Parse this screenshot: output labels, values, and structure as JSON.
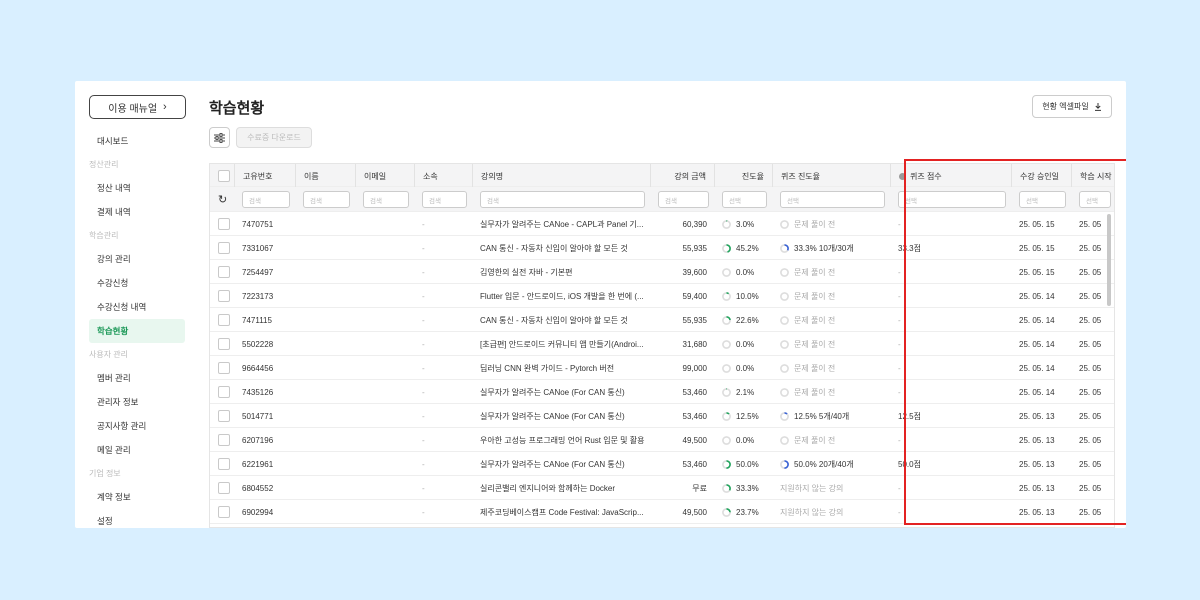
{
  "sidebar": {
    "menu_button": "이용 매뉴얼",
    "sections": [
      {
        "items": [
          "대시보드"
        ]
      },
      {
        "title": "정산관리",
        "items": [
          "정산 내역",
          "결제 내역"
        ]
      },
      {
        "title": "학습관리",
        "items": [
          "강의 관리",
          "수강신청",
          "수강신청 내역",
          "학습현황"
        ]
      },
      {
        "title": "사용자 관리",
        "items": [
          "멤버 관리",
          "관리자 정보",
          "공지사항 관리",
          "메일 관리"
        ]
      },
      {
        "title": "기업 정보",
        "items": [
          "계약 정보",
          "설정"
        ]
      }
    ],
    "active_item": "학습현황"
  },
  "header": {
    "title": "학습현황",
    "excel_button": "현황 엑셀파일",
    "certificate_download": "수료증 다운로드"
  },
  "table": {
    "columns": [
      "고유번호",
      "이름",
      "이메일",
      "소속",
      "강의명",
      "강의 금액",
      "진도율",
      "퀴즈 진도율",
      "퀴즈 점수",
      "수강 승인일",
      "학습 시작"
    ],
    "filter_placeholders": {
      "search": "검색",
      "select": "선택"
    },
    "rows": [
      {
        "id": "7470751",
        "org": "-",
        "course": "실무자가 알려주는 CANoe - CAPL과 Panel 기...",
        "price": "60,390",
        "progress": "3.0%",
        "progress_frac": 0.03,
        "quiz_progress": "문제 풀이 전",
        "quiz_frac": null,
        "quiz_score": "-",
        "approved": "25. 05. 15",
        "start": "25. 05"
      },
      {
        "id": "7331067",
        "org": "-",
        "course": "CAN 통신 - 자동차 신입이 알아야 할 모든 것",
        "price": "55,935",
        "progress": "45.2%",
        "progress_frac": 0.452,
        "quiz_progress": "33.3% 10개/30개",
        "quiz_frac": 0.333,
        "quiz_score": "33.3점",
        "approved": "25. 05. 15",
        "start": "25. 05"
      },
      {
        "id": "7254497",
        "org": "-",
        "course": "김영한의 실전 자바 - 기본편",
        "price": "39,600",
        "progress": "0.0%",
        "progress_frac": 0,
        "quiz_progress": "문제 풀이 전",
        "quiz_frac": null,
        "quiz_score": "-",
        "approved": "25. 05. 15",
        "start": "25. 05"
      },
      {
        "id": "7223173",
        "org": "-",
        "course": "Flutter 입문 - 안드로이드, iOS 개발을 한 번에 (...",
        "price": "59,400",
        "progress": "10.0%",
        "progress_frac": 0.1,
        "quiz_progress": "문제 풀이 전",
        "quiz_frac": null,
        "quiz_score": "-",
        "approved": "25. 05. 14",
        "start": "25. 05"
      },
      {
        "id": "7471115",
        "org": "-",
        "course": "CAN 통신 - 자동차 신입이 알아야 할 모든 것",
        "price": "55,935",
        "progress": "22.6%",
        "progress_frac": 0.226,
        "quiz_progress": "문제 풀이 전",
        "quiz_frac": null,
        "quiz_score": "-",
        "approved": "25. 05. 14",
        "start": "25. 05"
      },
      {
        "id": "5502228",
        "org": "-",
        "course": "[초급편] 안드로이드 커뮤니티 앱 만들기(Androi...",
        "price": "31,680",
        "progress": "0.0%",
        "progress_frac": 0,
        "quiz_progress": "문제 풀이 전",
        "quiz_frac": null,
        "quiz_score": "-",
        "approved": "25. 05. 14",
        "start": "25. 05"
      },
      {
        "id": "9664456",
        "org": "-",
        "course": "딥러닝 CNN 완벽 가이드 - Pytorch 버전",
        "price": "99,000",
        "progress": "0.0%",
        "progress_frac": 0,
        "quiz_progress": "문제 풀이 전",
        "quiz_frac": null,
        "quiz_score": "-",
        "approved": "25. 05. 14",
        "start": "25. 05"
      },
      {
        "id": "7435126",
        "org": "-",
        "course": "실무자가 알려주는 CANoe (For CAN 통신)",
        "price": "53,460",
        "progress": "2.1%",
        "progress_frac": 0.021,
        "quiz_progress": "문제 풀이 전",
        "quiz_frac": null,
        "quiz_score": "-",
        "approved": "25. 05. 14",
        "start": "25. 05"
      },
      {
        "id": "5014771",
        "org": "-",
        "course": "실무자가 알려주는 CANoe (For CAN 통신)",
        "price": "53,460",
        "progress": "12.5%",
        "progress_frac": 0.125,
        "quiz_progress": "12.5% 5개/40개",
        "quiz_frac": 0.125,
        "quiz_score": "12.5점",
        "approved": "25. 05. 13",
        "start": "25. 05"
      },
      {
        "id": "6207196",
        "org": "-",
        "course": "우아한 고성능 프로그래밍 언어 Rust 입문 및 활용",
        "price": "49,500",
        "progress": "0.0%",
        "progress_frac": 0,
        "quiz_progress": "문제 풀이 전",
        "quiz_frac": null,
        "quiz_score": "-",
        "approved": "25. 05. 13",
        "start": "25. 05"
      },
      {
        "id": "6221961",
        "org": "-",
        "course": "실무자가 알려주는 CANoe (For CAN 통신)",
        "price": "53,460",
        "progress": "50.0%",
        "progress_frac": 0.5,
        "quiz_progress": "50.0% 20개/40개",
        "quiz_frac": 0.5,
        "quiz_score": "50.0점",
        "approved": "25. 05. 13",
        "start": "25. 05"
      },
      {
        "id": "6804552",
        "org": "-",
        "course": "실리콘밸리 엔지니어와 함께하는 Docker",
        "price": "무료",
        "progress": "33.3%",
        "progress_frac": 0.333,
        "quiz_progress": "지원하지 않는 강의",
        "quiz_frac": null,
        "quiz_score": "-",
        "approved": "25. 05. 13",
        "start": "25. 05"
      },
      {
        "id": "6902994",
        "org": "-",
        "course": "제주코딩베이스캠프 Code Festival: JavaScrip...",
        "price": "49,500",
        "progress": "23.7%",
        "progress_frac": 0.237,
        "quiz_progress": "지원하지 않는 강의",
        "quiz_frac": null,
        "quiz_score": "-",
        "approved": "25. 05. 13",
        "start": "25. 05"
      }
    ]
  },
  "colors": {
    "accent_green": "#22a55e",
    "quiz_blue": "#3a63d6",
    "highlight_red": "#e32222"
  },
  "icons": [
    "chevron-right-icon",
    "download-icon",
    "filter-sliders-icon",
    "reset-icon",
    "info-icon"
  ]
}
